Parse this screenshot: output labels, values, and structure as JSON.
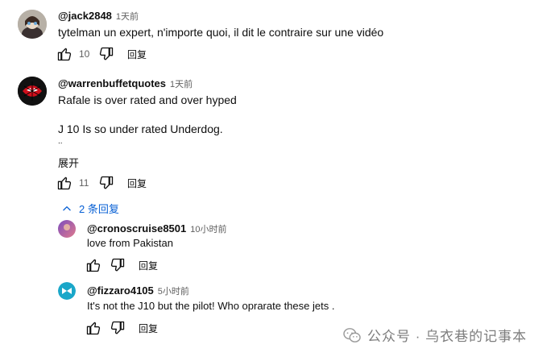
{
  "comments": [
    {
      "author": "@jack2848",
      "time": "1天前",
      "text": "tytelman un expert, n'importe quoi, il dit le contraire sur une vidéo",
      "likes": "10",
      "reply_label": "回复"
    },
    {
      "author": "@warrenbuffetquotes",
      "time": "1天前",
      "text_lines": [
        "Rafale is over rated and over hyped",
        "J 10 Is so under rated Underdog.",
        ".."
      ],
      "expand_label": "展开",
      "likes": "11",
      "reply_label": "回复",
      "replies_toggle": "2 条回复",
      "replies": [
        {
          "author": "@cronoscruise8501",
          "time": "10小时前",
          "text": "love from Pakistan",
          "reply_label": "回复"
        },
        {
          "author": "@fizzaro4105",
          "time": "5小时前",
          "text": "It's not the J10 but the pilot! Who oprarate these jets .",
          "reply_label": "回复"
        }
      ]
    }
  ],
  "icons": {
    "like": "thumbs-up-icon",
    "dislike": "thumbs-down-icon",
    "toggle": "chevron-up-icon",
    "watermark": "wechat-icon"
  },
  "colors": {
    "link": "#065fd4",
    "secondary_text": "#606060",
    "watermark": "#7d7d7d"
  },
  "watermark": {
    "text": "公众号 · 乌衣巷的记事本"
  }
}
